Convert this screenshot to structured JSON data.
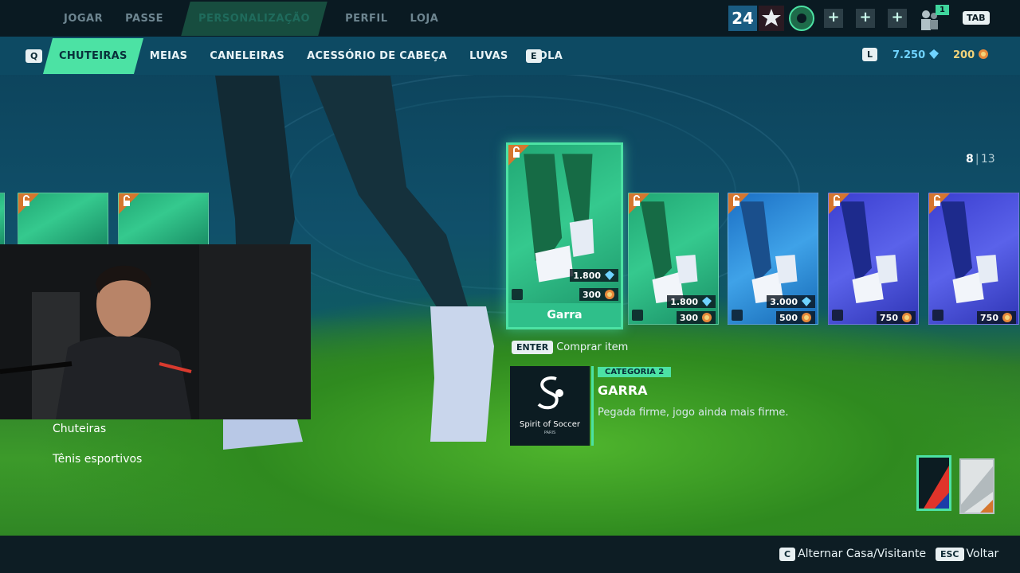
{
  "top_nav": {
    "items": [
      "JOGAR",
      "PASSE",
      "PERSONALIZAÇÃO",
      "PERFIL",
      "LOJA"
    ],
    "level": "24",
    "friends_count": "1",
    "tab_key": "TAB"
  },
  "category_bar": {
    "prev_key": "Q",
    "next_key": "E",
    "tabs": [
      "CHUTEIRAS",
      "MEIAS",
      "CANELEIRAS",
      "ACESSÓRIO DE CABEÇA",
      "LUVAS",
      "BOLA"
    ],
    "currency_key": "L",
    "gems": "7.250",
    "coins": "200"
  },
  "pager": {
    "current": "8",
    "total": "13"
  },
  "selected_item": {
    "name": "Garra",
    "gem_price": "1.800",
    "coin_price": "300"
  },
  "cards": [
    {
      "gem_price": "1.800",
      "coin_price": "300"
    },
    {
      "gem_price": "3.000",
      "coin_price": "500"
    },
    {
      "coin_price": "750"
    },
    {
      "coin_price": "750"
    }
  ],
  "buy_hint": {
    "key": "ENTER",
    "label": "Comprar item"
  },
  "detail": {
    "brand_name": "Spirit of Soccer",
    "brand_sub": "PARIS",
    "category": "CATEGORIA 2",
    "title": "GARRA",
    "description": "Pegada firme, jogo ainda mais firme."
  },
  "side_menu": [
    "Chuteiras",
    "Tênis esportivos"
  ],
  "bottom_hints": {
    "toggle_key": "C",
    "toggle_label": "Alternar Casa/Visitante",
    "back_key": "ESC",
    "back_label": "Voltar"
  },
  "colors": {
    "accent": "#4ce2a4",
    "gem": "#6fd3ff",
    "coin": "#f2d37a"
  }
}
